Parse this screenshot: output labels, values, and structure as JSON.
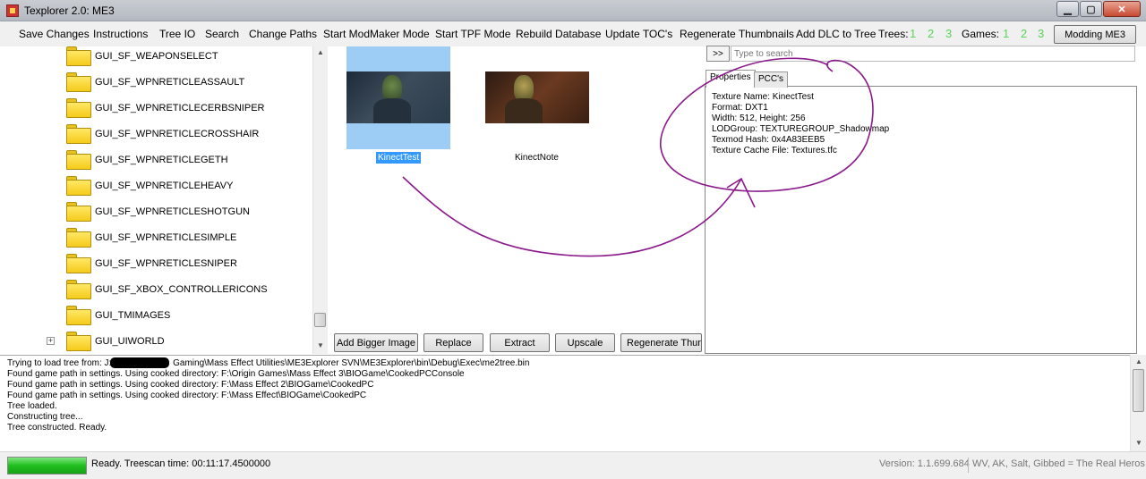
{
  "window": {
    "title": "Texplorer 2.0:  ME3"
  },
  "menu": {
    "items": [
      "Save Changes",
      "Instructions",
      "Tree IO",
      "Search",
      "Change Paths",
      "Start ModMaker Mode",
      "Start TPF Mode",
      "Rebuild Database",
      "Update TOC's",
      "Regenerate Thumbnails",
      "Add DLC to Tree"
    ],
    "trees_label": "Trees:",
    "trees": [
      "1",
      "2",
      "3"
    ],
    "games_label": "Games:",
    "games": [
      "1",
      "2",
      "3"
    ],
    "mode_button": "Modding ME3"
  },
  "tree": {
    "nodes": [
      "GUI_SF_WEAPONSELECT",
      "GUI_SF_WPNRETICLEASSAULT",
      "GUI_SF_WPNRETICLECERBSNIPER",
      "GUI_SF_WPNRETICLECROSSHAIR",
      "GUI_SF_WPNRETICLEGETH",
      "GUI_SF_WPNRETICLEHEAVY",
      "GUI_SF_WPNRETICLESHOTGUN",
      "GUI_SF_WPNRETICLESIMPLE",
      "GUI_SF_WPNRETICLESNIPER",
      "GUI_SF_XBOX_CONTROLLERICONS",
      "GUI_TMIMAGES",
      "GUI_UIWORLD"
    ],
    "expander": "+"
  },
  "thumbnails": [
    {
      "name": "KinectTest",
      "selected": true
    },
    {
      "name": "KinectNote",
      "selected": false
    }
  ],
  "actions": [
    "Add Bigger Image",
    "Replace",
    "Extract",
    "Upscale",
    "Regenerate Thumb"
  ],
  "search": {
    "button": ">>",
    "placeholder": "Type to search"
  },
  "tabs": [
    "Properties",
    "PCC's"
  ],
  "properties": [
    "Texture Name:  KinectTest",
    "Format:  DXT1",
    "Width:  512,  Height:  256",
    "LODGroup:  TEXTUREGROUP_Shadowmap",
    "Texmod Hash:  0x4A83EEB5",
    "Texture Cache File:  Textures.tfc"
  ],
  "log": {
    "line1_prefix": "Trying to load tree from:  J:\\",
    "line1_suffix": "Gaming\\Mass Effect Utilities\\ME3Explorer SVN\\ME3Explorer\\bin\\Debug\\Exec\\me2tree.bin",
    "lines": [
      "Found game path in settings. Using cooked directory: F:\\Origin Games\\Mass Effect 3\\BIOGame\\CookedPCConsole",
      "Found game path in settings. Using cooked directory: F:\\Mass Effect 2\\BIOGame\\CookedPC",
      "Found game path in settings. Using cooked directory: F:\\Mass Effect\\BIOGame\\CookedPC",
      "Tree loaded.",
      "Constructing tree...",
      "Tree constructed. Ready."
    ]
  },
  "status": {
    "progress_fraction": 1.0,
    "text": "Ready.   Treescan time: 00:11:17.4500000",
    "version": "Version: 1.1.699.684",
    "credits": "WV, AK, Salt, Gibbed = The Real Heros"
  },
  "colors": {
    "selection": "#9dcdf5",
    "caption_highlight": "#3399ff",
    "annotation": "#8b1a8b",
    "number_green": "#5bd35b"
  }
}
